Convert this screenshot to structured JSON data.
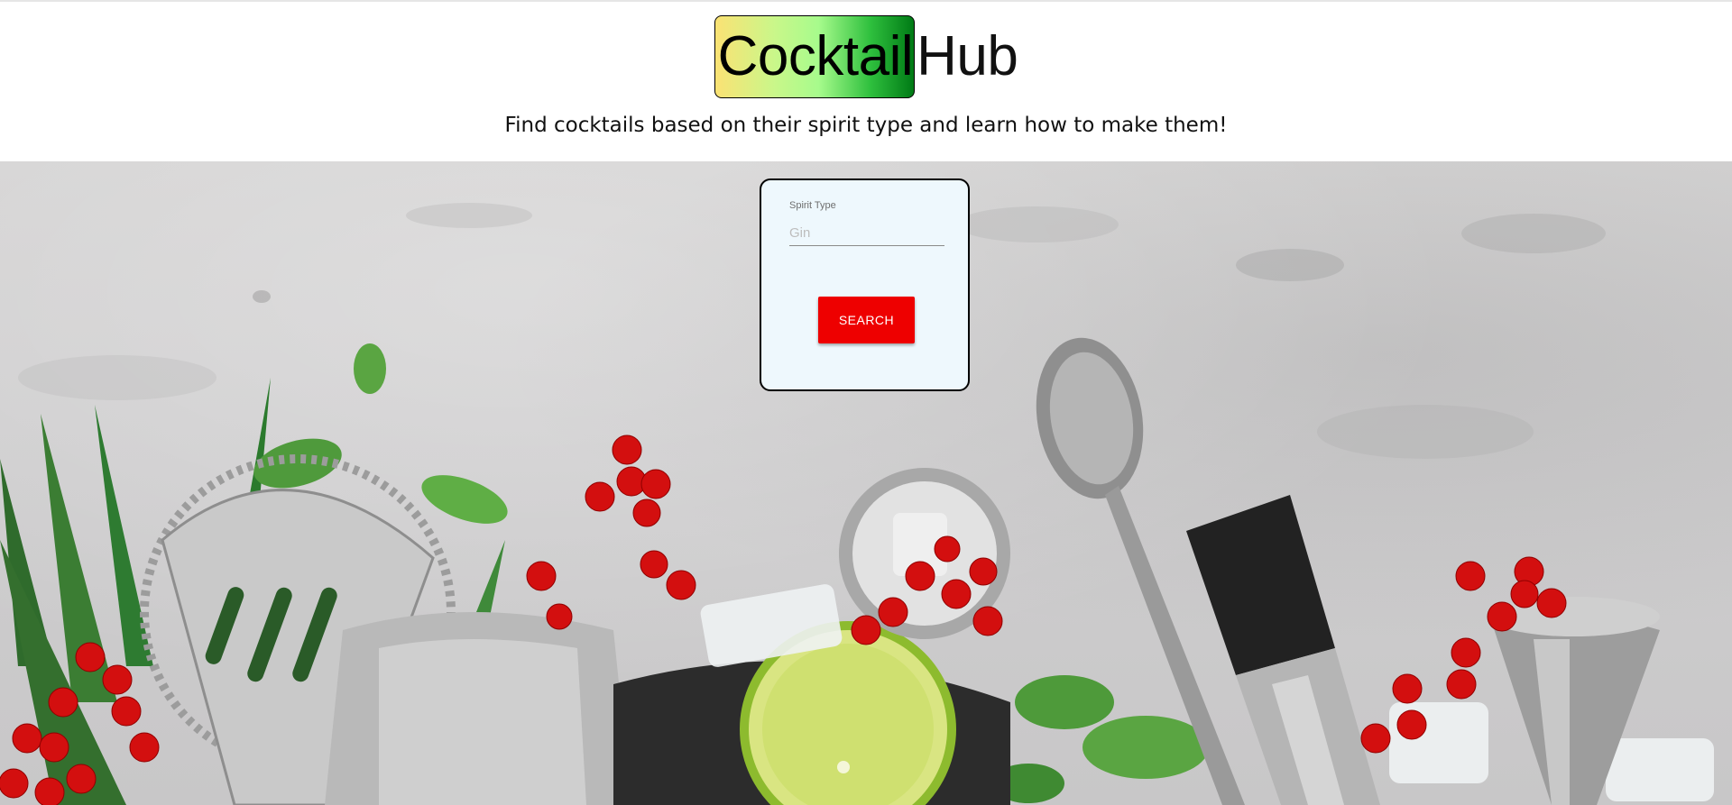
{
  "app": {
    "logo_part1": "Cocktail",
    "logo_part2": "Hub",
    "tagline": "Find cocktails based on their spirit type and learn how to make them!"
  },
  "search": {
    "label": "Spirit Type",
    "placeholder": "Gin",
    "value": "",
    "button_label": "SEARCH"
  },
  "colors": {
    "button": "#ee0000",
    "card_background": "#eef8fd",
    "logo_gradient_start": "#fbe274",
    "logo_gradient_end": "#007a15"
  },
  "hero_image": {
    "icon_names": [
      "leaf-icon",
      "cocktail-strainer-icon",
      "shaker-icon",
      "red-currant-icon",
      "lime-icon",
      "mint-icon",
      "bar-spoon-icon",
      "muddler-icon",
      "jigger-icon",
      "ice-cube-icon",
      "bowl-icon"
    ]
  }
}
